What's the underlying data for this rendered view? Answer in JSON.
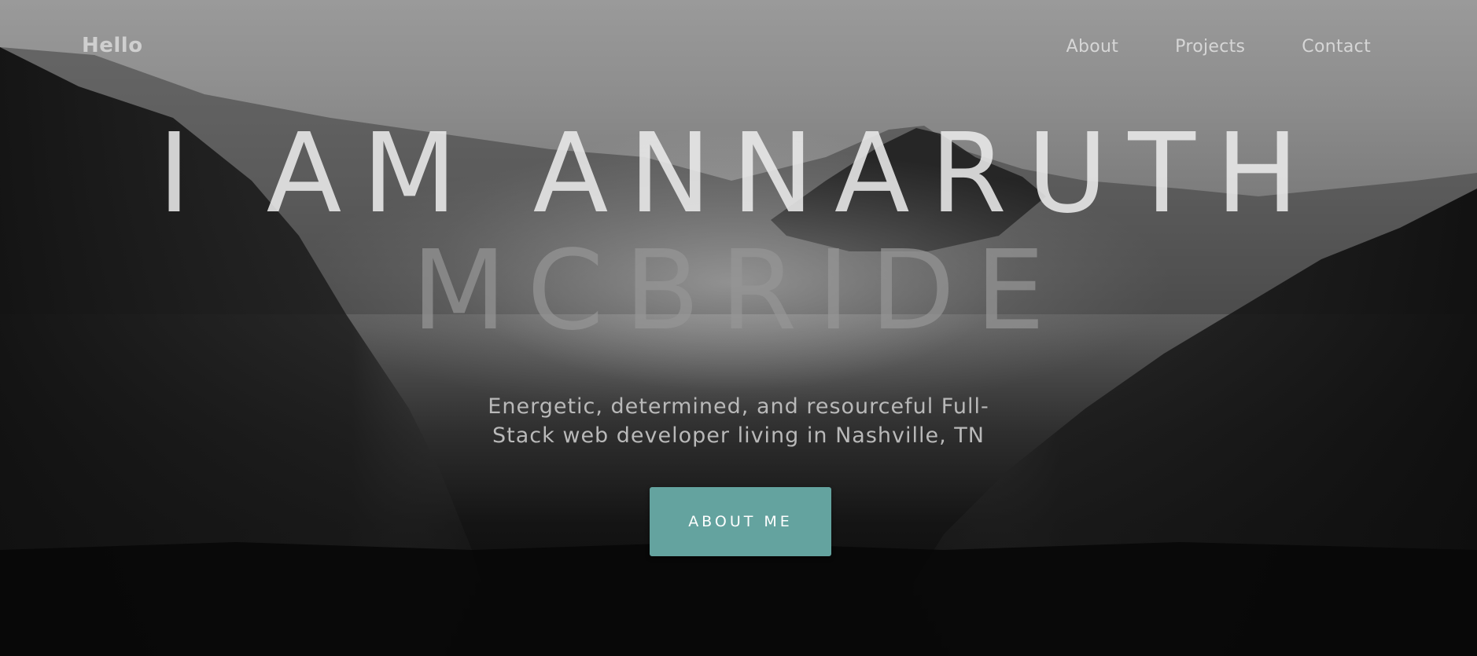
{
  "nav": {
    "brand": "Hello",
    "links": [
      "About",
      "Projects",
      "Contact"
    ]
  },
  "hero": {
    "headline_line1": "I AM ANNARUTH",
    "headline_line2": "MCBRIDE",
    "tagline_line1": "Energetic, determined, and resourceful Full-",
    "tagline_line2": "Stack web developer living in Nashville, TN",
    "cta_label": "ABOUT ME",
    "background": "misty-forest-mountains-photo"
  },
  "colors": {
    "accent": "#64a39f",
    "button_text": "#ffffff",
    "nav_text": "#d6d6d6"
  }
}
